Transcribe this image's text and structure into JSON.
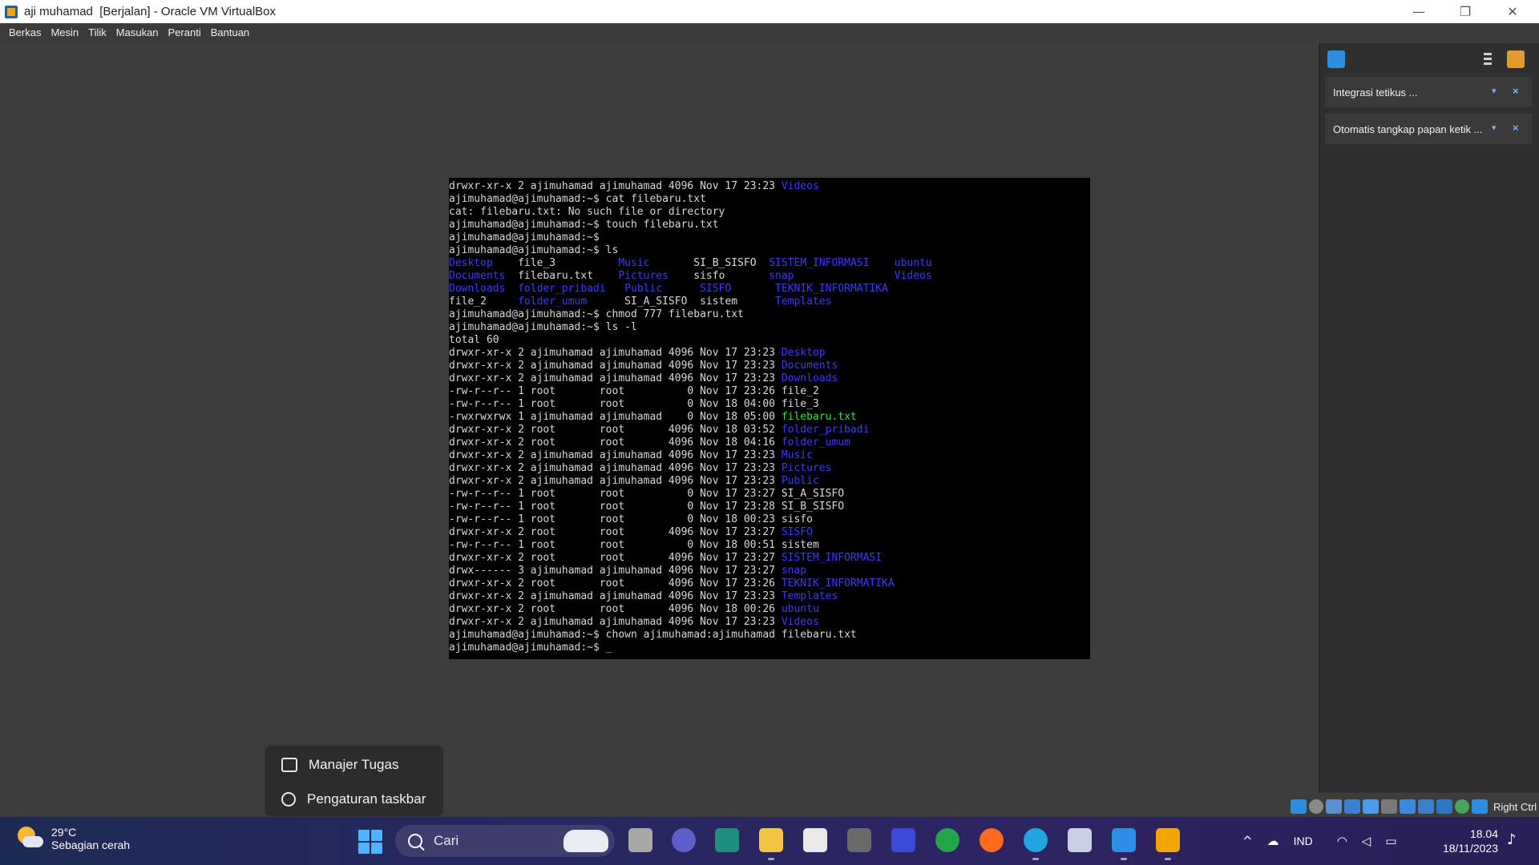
{
  "window": {
    "title": "aji muhamad  [Berjalan] - Oracle VM VirtualBox",
    "min_glyph": "—",
    "max_glyph": "❐",
    "close_glyph": "✕"
  },
  "menu": [
    "Berkas",
    "Mesin",
    "Tilik",
    "Masukan",
    "Peranti",
    "Bantuan"
  ],
  "terminal": {
    "lines": [
      [
        {
          "t": "drwxr-xr-x 2 ajimuhamad ajimuhamad 4096 Nov 17 23:23 "
        },
        {
          "t": "Videos",
          "c": "blue"
        }
      ],
      [
        {
          "t": "ajimuhamad@ajimuhamad:~$ cat filebaru.txt"
        }
      ],
      [
        {
          "t": "cat: filebaru.txt: No such file or directory"
        }
      ],
      [
        {
          "t": "ajimuhamad@ajimuhamad:~$ touch filebaru.txt"
        }
      ],
      [
        {
          "t": "ajimuhamad@ajimuhamad:~$"
        }
      ],
      [
        {
          "t": "ajimuhamad@ajimuhamad:~$ ls"
        }
      ],
      [
        {
          "t": "Desktop",
          "c": "blue"
        },
        {
          "t": "    file_3          "
        },
        {
          "t": "Music",
          "c": "blue"
        },
        {
          "t": "       SI_B_SISFO  "
        },
        {
          "t": "SISTEM_INFORMASI",
          "c": "blue"
        },
        {
          "t": "    "
        },
        {
          "t": "ubuntu",
          "c": "blue"
        }
      ],
      [
        {
          "t": "Documents",
          "c": "blue"
        },
        {
          "t": "  filebaru.txt    "
        },
        {
          "t": "Pictures",
          "c": "blue"
        },
        {
          "t": "    sisfo       "
        },
        {
          "t": "snap",
          "c": "blue"
        },
        {
          "t": "                "
        },
        {
          "t": "Videos",
          "c": "blue"
        }
      ],
      [
        {
          "t": "Downloads",
          "c": "blue"
        },
        {
          "t": "  "
        },
        {
          "t": "folder_pribadi",
          "c": "blue"
        },
        {
          "t": "   "
        },
        {
          "t": "Public",
          "c": "blue"
        },
        {
          "t": "      "
        },
        {
          "t": "SISFO",
          "c": "blue"
        },
        {
          "t": "       "
        },
        {
          "t": "TEKNIK_INFORMATIKA",
          "c": "blue"
        }
      ],
      [
        {
          "t": "file_2     "
        },
        {
          "t": "folder_umum",
          "c": "blue"
        },
        {
          "t": "      SI_A_SISFO  sistem      "
        },
        {
          "t": "Templates",
          "c": "blue"
        }
      ],
      [
        {
          "t": "ajimuhamad@ajimuhamad:~$ chmod 777 filebaru.txt"
        }
      ],
      [
        {
          "t": "ajimuhamad@ajimuhamad:~$ ls -l"
        }
      ],
      [
        {
          "t": "total 60"
        }
      ],
      [
        {
          "t": "drwxr-xr-x 2 ajimuhamad ajimuhamad 4096 Nov 17 23:23 "
        },
        {
          "t": "Desktop",
          "c": "blue"
        }
      ],
      [
        {
          "t": "drwxr-xr-x 2 ajimuhamad ajimuhamad 4096 Nov 17 23:23 "
        },
        {
          "t": "Documents",
          "c": "blue"
        }
      ],
      [
        {
          "t": "drwxr-xr-x 2 ajimuhamad ajimuhamad 4096 Nov 17 23:23 "
        },
        {
          "t": "Downloads",
          "c": "blue"
        }
      ],
      [
        {
          "t": "-rw-r--r-- 1 root       root          0 Nov 17 23:26 file_2"
        }
      ],
      [
        {
          "t": "-rw-r--r-- 1 root       root          0 Nov 18 04:00 file_3"
        }
      ],
      [
        {
          "t": "-rwxrwxrwx 1 ajimuhamad ajimuhamad    0 Nov 18 05:00 "
        },
        {
          "t": "filebaru.txt",
          "c": "green"
        }
      ],
      [
        {
          "t": "drwxr-xr-x 2 root       root       4096 Nov 18 03:52 "
        },
        {
          "t": "folder_pribadi",
          "c": "blue"
        }
      ],
      [
        {
          "t": "drwxr-xr-x 2 root       root       4096 Nov 18 04:16 "
        },
        {
          "t": "folder_umum",
          "c": "blue"
        }
      ],
      [
        {
          "t": "drwxr-xr-x 2 ajimuhamad ajimuhamad 4096 Nov 17 23:23 "
        },
        {
          "t": "Music",
          "c": "blue"
        }
      ],
      [
        {
          "t": "drwxr-xr-x 2 ajimuhamad ajimuhamad 4096 Nov 17 23:23 "
        },
        {
          "t": "Pictures",
          "c": "blue"
        }
      ],
      [
        {
          "t": "drwxr-xr-x 2 ajimuhamad ajimuhamad 4096 Nov 17 23:23 "
        },
        {
          "t": "Public",
          "c": "blue"
        }
      ],
      [
        {
          "t": "-rw-r--r-- 1 root       root          0 Nov 17 23:27 SI_A_SISFO"
        }
      ],
      [
        {
          "t": "-rw-r--r-- 1 root       root          0 Nov 17 23:28 SI_B_SISFO"
        }
      ],
      [
        {
          "t": "-rw-r--r-- 1 root       root          0 Nov 18 00:23 sisfo"
        }
      ],
      [
        {
          "t": "drwxr-xr-x 2 root       root       4096 Nov 17 23:27 "
        },
        {
          "t": "SISFO",
          "c": "blue"
        }
      ],
      [
        {
          "t": "-rw-r--r-- 1 root       root          0 Nov 18 00:51 sistem"
        }
      ],
      [
        {
          "t": "drwxr-xr-x 2 root       root       4096 Nov 17 23:27 "
        },
        {
          "t": "SISTEM_INFORMASI",
          "c": "blue"
        }
      ],
      [
        {
          "t": "drwx------ 3 ajimuhamad ajimuhamad 4096 Nov 17 23:27 "
        },
        {
          "t": "snap",
          "c": "blue"
        }
      ],
      [
        {
          "t": "drwxr-xr-x 2 root       root       4096 Nov 17 23:26 "
        },
        {
          "t": "TEKNIK_INFORMATIKA",
          "c": "blue"
        }
      ],
      [
        {
          "t": "drwxr-xr-x 2 ajimuhamad ajimuhamad 4096 Nov 17 23:23 "
        },
        {
          "t": "Templates",
          "c": "blue"
        }
      ],
      [
        {
          "t": "drwxr-xr-x 2 root       root       4096 Nov 18 00:26 "
        },
        {
          "t": "ubuntu",
          "c": "blue"
        }
      ],
      [
        {
          "t": "drwxr-xr-x 2 ajimuhamad ajimuhamad 4096 Nov 17 23:23 "
        },
        {
          "t": "Videos",
          "c": "blue"
        }
      ],
      [
        {
          "t": "ajimuhamad@ajimuhamad:~$ chown ajimuhamad:ajimuhamad filebaru.txt"
        }
      ],
      [
        {
          "t": "ajimuhamad@ajimuhamad:~$ _"
        }
      ]
    ]
  },
  "notifications": {
    "items": [
      {
        "text": "Integrasi tetikus ..."
      },
      {
        "text": "Otomatis tangkap papan ketik ..."
      }
    ]
  },
  "vm_status": {
    "host_key": "Right Ctrl"
  },
  "context_menu": {
    "items": [
      "Manajer Tugas",
      "Pengaturan taskbar"
    ]
  },
  "taskbar": {
    "weather_temp": "29°C",
    "weather_desc": "Sebagian cerah",
    "search_placeholder": "Cari",
    "language": "IND",
    "time": "18.04",
    "date": "18/11/2023"
  },
  "colors": {
    "terminal_blue": "#3b3bff",
    "terminal_green": "#3fdd3f",
    "accent": "#4fb3ff"
  }
}
